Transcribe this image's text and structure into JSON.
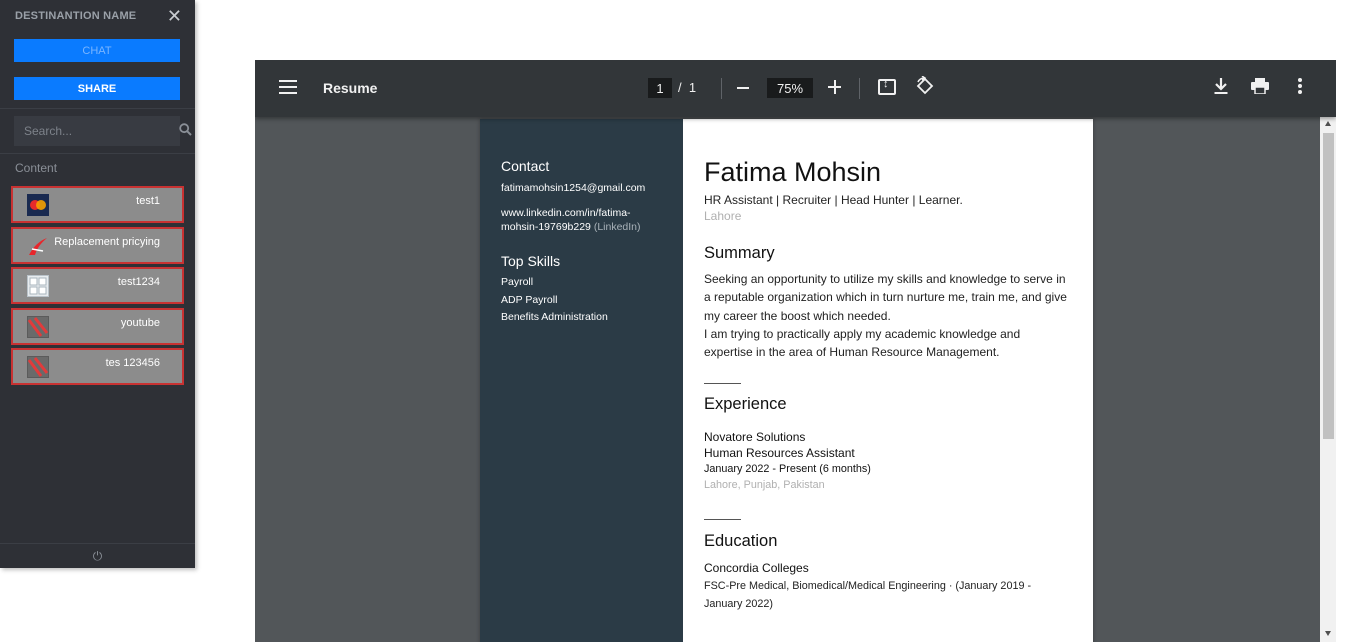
{
  "sidebar": {
    "title": "DESTINANTION NAME",
    "close_icon": "close-icon",
    "chat_label": "CHAT",
    "share_label": "SHARE",
    "search_placeholder": "Search...",
    "section_label": "Content",
    "items": [
      {
        "label": "test1",
        "thumb": "mastercard"
      },
      {
        "label": "Replacement pricying",
        "thumb": "swoosh"
      },
      {
        "label": "test1234",
        "thumb": "grid"
      },
      {
        "label": "youtube",
        "thumb": "broken-image"
      },
      {
        "label": "tes 123456",
        "thumb": "broken-image"
      }
    ],
    "footer_icon": "⏻"
  },
  "viewer": {
    "title": "Resume",
    "page_current": "1",
    "page_sep": "/",
    "page_total": "1",
    "zoom": "75%"
  },
  "resume": {
    "contact_heading": "Contact",
    "email": "fatimamohsin1254@gmail.com",
    "linkedin_line1": "www.linkedin.com/in/fatima-",
    "linkedin_line2": "mohsin-19769b229",
    "linkedin_suffix": " (LinkedIn)",
    "skills_heading": "Top Skills",
    "skills": [
      "Payroll",
      "ADP Payroll",
      "Benefits Administration"
    ],
    "name": "Fatima Mohsin",
    "headline": "HR Assistant | Recruiter | Head Hunter | Learner.",
    "location": "Lahore",
    "summary_heading": "Summary",
    "summary_1": "Seeking an opportunity to utilize my skills and knowledge to serve in a reputable organization which in turn nurture me, train me, and give my career the boost which needed.",
    "summary_2": "I am trying to practically apply my academic knowledge and expertise in the area of Human Resource Management.",
    "experience_heading": "Experience",
    "company": "Novatore Solutions",
    "role": "Human Resources Assistant",
    "dates": "January 2022 - Present (6 months)",
    "job_location": "Lahore, Punjab, Pakistan",
    "education_heading": "Education",
    "school": "Concordia Colleges",
    "degree": "FSC-Pre Medical, Biomedical/Medical Engineering · (January 2019 - January 2022)"
  }
}
